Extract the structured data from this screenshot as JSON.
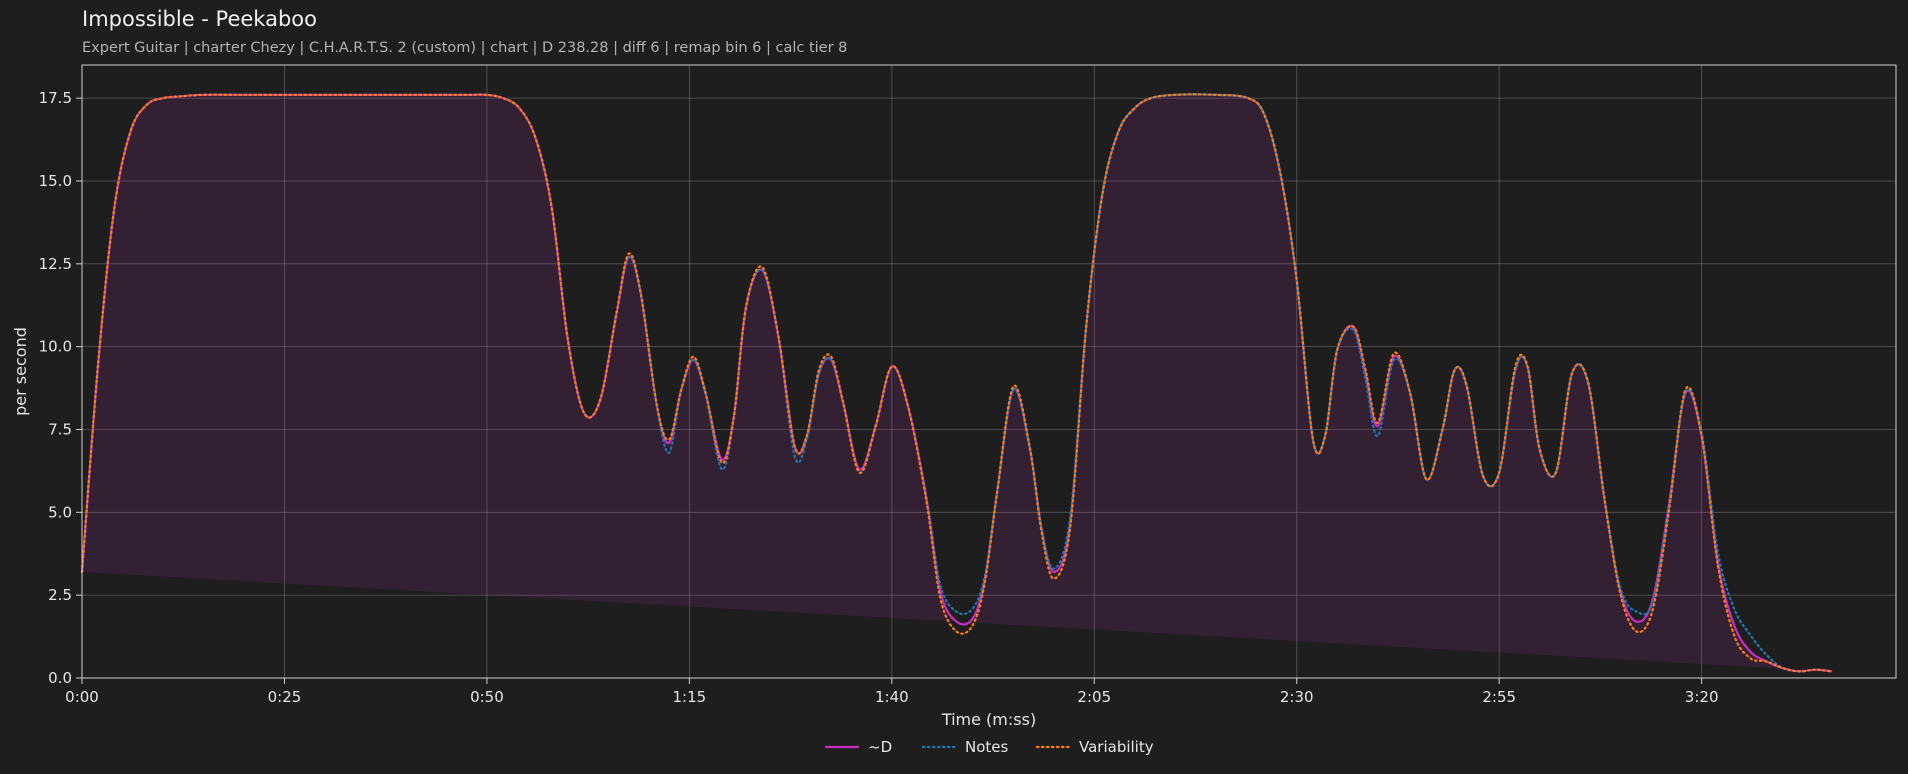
{
  "title": "Impossible - Peekaboo",
  "subtitle": "Expert Guitar  |  charter Chezy  |  C.H.A.R.T.S. 2 (custom)  |  chart  |  D 238.28  |  diff 6  |  remap bin 6  |  calc tier 8",
  "chart_data": {
    "type": "line",
    "title": "Impossible - Peekaboo",
    "xlabel": "Time (m:ss)",
    "ylabel": "per second",
    "xlim": [
      0,
      224
    ],
    "ylim": [
      0,
      18.5
    ],
    "x_ticks": [
      {
        "value": 0,
        "label": "0:00"
      },
      {
        "value": 25,
        "label": "0:25"
      },
      {
        "value": 50,
        "label": "0:50"
      },
      {
        "value": 75,
        "label": "1:15"
      },
      {
        "value": 100,
        "label": "1:40"
      },
      {
        "value": 125,
        "label": "2:05"
      },
      {
        "value": 150,
        "label": "2:30"
      },
      {
        "value": 175,
        "label": "2:55"
      },
      {
        "value": 200,
        "label": "3:20"
      }
    ],
    "y_ticks": [
      {
        "value": 0,
        "label": "0.0"
      },
      {
        "value": 2.5,
        "label": "2.5"
      },
      {
        "value": 5,
        "label": "5.0"
      },
      {
        "value": 7.5,
        "label": "7.5"
      },
      {
        "value": 10,
        "label": "10.0"
      },
      {
        "value": 12.5,
        "label": "12.5"
      },
      {
        "value": 15,
        "label": "15.0"
      },
      {
        "value": 17.5,
        "label": "17.5"
      }
    ],
    "grid": true,
    "legend_position": "bottom-center",
    "x": [
      0,
      2,
      4,
      6,
      8,
      10,
      12,
      15,
      20,
      25,
      30,
      35,
      40,
      45,
      48,
      50,
      52,
      54,
      56,
      58,
      60,
      62,
      64,
      66,
      67.5,
      69,
      71,
      72.5,
      74,
      75.5,
      77,
      79,
      80.5,
      82,
      84,
      86,
      88,
      89.5,
      91,
      92.5,
      94,
      96,
      98,
      100,
      102,
      104.3,
      106,
      108,
      110,
      111.5,
      113,
      115,
      117,
      118.5,
      120,
      122,
      124,
      126,
      128,
      130,
      132,
      135,
      140,
      144,
      146,
      148,
      150,
      152,
      153.5,
      155,
      157,
      158.5,
      160,
      162,
      164,
      166,
      168,
      169.5,
      171,
      173,
      175,
      177,
      178.5,
      180,
      182,
      184,
      186,
      188,
      190,
      192,
      194,
      196,
      198,
      200,
      202,
      204,
      206,
      208,
      210,
      212,
      214,
      216,
      218,
      220,
      222,
      224
    ],
    "series": [
      {
        "name": "~D",
        "color": "#c72fc0",
        "style": "solid",
        "values": [
          3.2,
          9.5,
          14.2,
          16.5,
          17.3,
          17.5,
          17.55,
          17.6,
          17.6,
          17.6,
          17.6,
          17.6,
          17.6,
          17.6,
          17.6,
          17.6,
          17.5,
          17.2,
          16.3,
          14.2,
          10.2,
          8.0,
          8.4,
          11.0,
          12.7,
          11.6,
          8.2,
          7.1,
          8.7,
          9.6,
          8.6,
          6.6,
          7.9,
          11.2,
          12.3,
          10.3,
          7.0,
          7.3,
          9.2,
          9.6,
          8.3,
          6.3,
          7.6,
          9.4,
          8.2,
          5.4,
          2.6,
          1.7,
          1.8,
          3.0,
          5.6,
          8.7,
          7.0,
          4.5,
          3.2,
          4.6,
          10.6,
          14.6,
          16.5,
          17.2,
          17.5,
          17.6,
          17.6,
          17.5,
          17.0,
          15.2,
          12.0,
          7.2,
          7.3,
          9.9,
          10.6,
          9.2,
          7.6,
          9.7,
          8.6,
          6.0,
          7.5,
          9.3,
          8.8,
          6.1,
          6.2,
          9.3,
          9.4,
          6.9,
          6.2,
          9.2,
          8.9,
          5.4,
          2.6,
          1.7,
          2.4,
          5.3,
          8.6,
          7.3,
          3.5,
          1.6,
          0.8,
          0.5,
          0.3,
          0.2,
          0.25,
          0.2,
          0.1
        ]
      },
      {
        "name": "Notes",
        "color": "#1f77b4",
        "style": "dotted",
        "values": [
          3.2,
          9.5,
          14.2,
          16.5,
          17.3,
          17.5,
          17.55,
          17.6,
          17.6,
          17.6,
          17.6,
          17.6,
          17.6,
          17.6,
          17.6,
          17.6,
          17.5,
          17.2,
          16.3,
          14.2,
          10.2,
          8.0,
          8.4,
          11.0,
          12.7,
          11.6,
          8.2,
          6.8,
          8.7,
          9.6,
          8.6,
          6.3,
          7.9,
          11.2,
          12.3,
          10.3,
          6.7,
          7.2,
          9.2,
          9.6,
          8.3,
          6.2,
          7.6,
          9.4,
          8.2,
          5.4,
          2.8,
          2.0,
          2.1,
          3.1,
          5.6,
          8.7,
          7.0,
          4.5,
          3.3,
          4.8,
          10.6,
          14.6,
          16.5,
          17.2,
          17.5,
          17.6,
          17.6,
          17.5,
          17.0,
          15.2,
          12.0,
          7.2,
          7.3,
          9.9,
          10.5,
          9.0,
          7.3,
          9.6,
          8.6,
          6.0,
          7.5,
          9.3,
          8.8,
          6.1,
          6.2,
          9.3,
          9.4,
          6.9,
          6.2,
          9.2,
          8.9,
          5.4,
          2.7,
          2.0,
          2.3,
          5.2,
          8.6,
          7.4,
          3.8,
          2.1,
          1.3,
          0.7,
          0.3,
          0.2,
          0.25,
          0.2,
          0.1
        ]
      },
      {
        "name": "Variability",
        "color": "#ff7f0e",
        "style": "dotted",
        "values": [
          3.2,
          9.5,
          14.2,
          16.5,
          17.3,
          17.5,
          17.55,
          17.6,
          17.6,
          17.6,
          17.6,
          17.6,
          17.6,
          17.6,
          17.6,
          17.6,
          17.5,
          17.2,
          16.3,
          14.2,
          10.2,
          8.0,
          8.4,
          11.0,
          12.8,
          11.6,
          8.2,
          7.2,
          8.7,
          9.7,
          8.6,
          6.5,
          7.9,
          11.2,
          12.4,
          10.3,
          7.0,
          7.3,
          9.3,
          9.7,
          8.3,
          6.2,
          7.6,
          9.4,
          8.2,
          5.3,
          2.4,
          1.4,
          1.6,
          2.9,
          5.6,
          8.8,
          7.0,
          4.4,
          3.0,
          4.5,
          10.6,
          14.6,
          16.5,
          17.2,
          17.5,
          17.6,
          17.6,
          17.5,
          17.0,
          15.2,
          12.0,
          7.2,
          7.3,
          9.9,
          10.6,
          9.3,
          7.7,
          9.8,
          8.6,
          6.0,
          7.5,
          9.3,
          8.8,
          6.1,
          6.2,
          9.4,
          9.4,
          6.9,
          6.2,
          9.2,
          8.9,
          5.4,
          2.5,
          1.4,
          2.1,
          5.1,
          8.7,
          7.3,
          3.4,
          1.3,
          0.6,
          0.5,
          0.3,
          0.2,
          0.25,
          0.2,
          0.1
        ]
      }
    ]
  },
  "legend": {
    "items": [
      {
        "label": "~D",
        "color": "#c72fc0",
        "style": "solid"
      },
      {
        "label": "Notes",
        "color": "#1f77b4",
        "style": "dotted"
      },
      {
        "label": "Variability",
        "color": "#ff7f0e",
        "style": "dotted"
      }
    ]
  },
  "colors": {
    "background": "#1e1e1e",
    "fill": "#c72fc0",
    "grid": "#8a8a8a",
    "axis": "#d0d0d0"
  }
}
